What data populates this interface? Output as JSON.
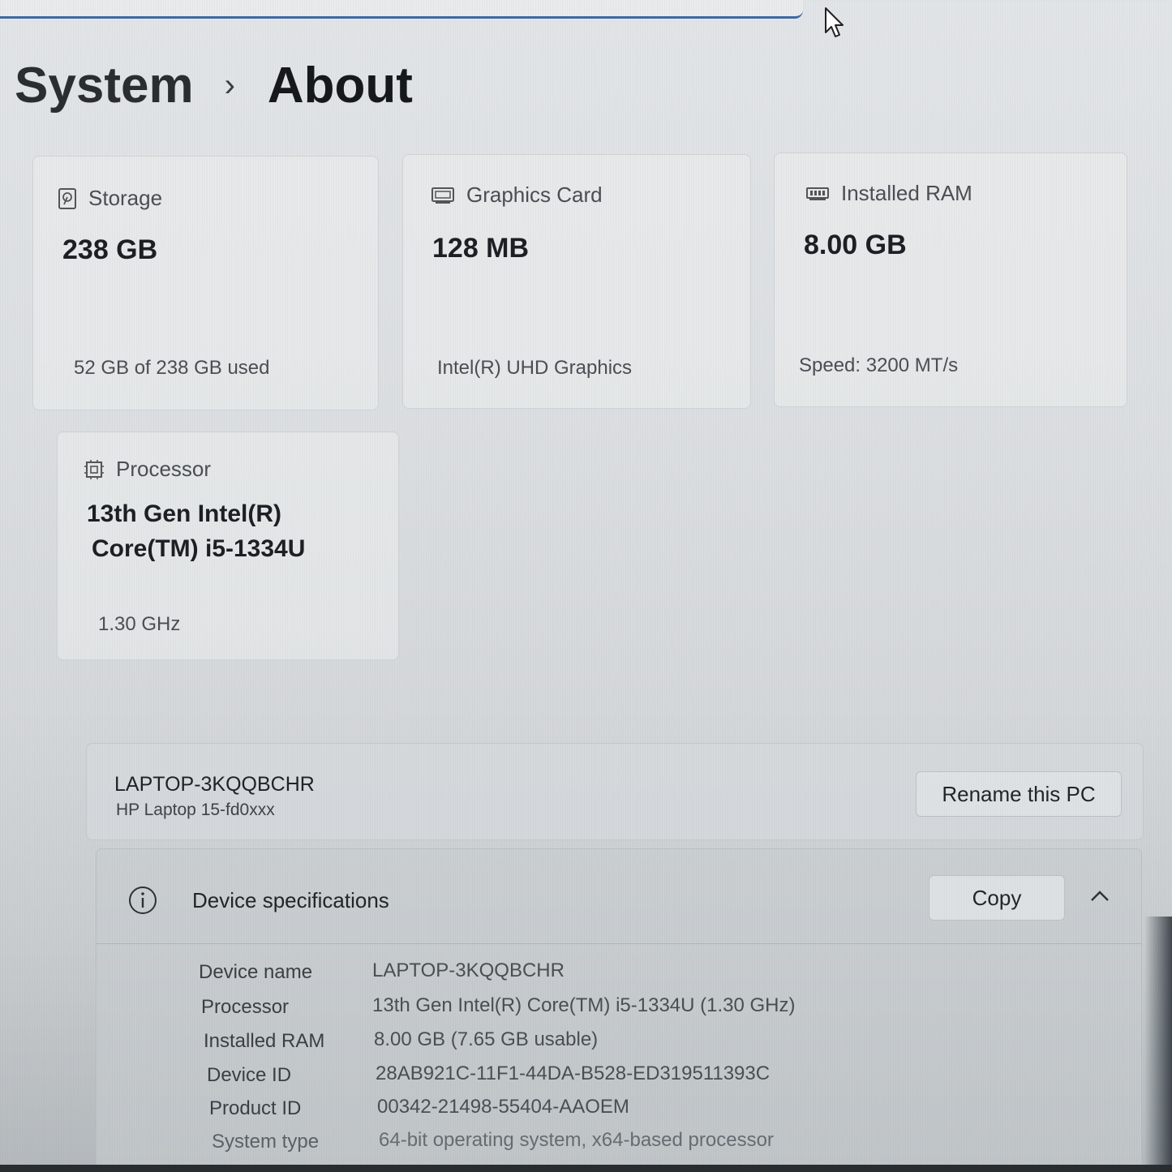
{
  "breadcrumb": {
    "parent": "System",
    "separator": "›",
    "current": "About"
  },
  "cards": {
    "storage": {
      "title": "Storage",
      "icon": "hard-drive-icon",
      "value": "238 GB",
      "detail": "52 GB of 238 GB used"
    },
    "graphics": {
      "title": "Graphics Card",
      "icon": "graphics-card-icon",
      "value": "128 MB",
      "detail": "Intel(R) UHD Graphics"
    },
    "ram": {
      "title": "Installed RAM",
      "icon": "ram-icon",
      "value": "8.00 GB",
      "detail": "Speed: 3200 MT/s"
    },
    "processor": {
      "title": "Processor",
      "icon": "processor-icon",
      "value_line1": "13th Gen Intel(R)",
      "value_line2": "Core(TM) i5-1334U",
      "detail": "1.30 GHz"
    }
  },
  "pc": {
    "name": "LAPTOP-3KQQBCHR",
    "model": "HP Laptop 15-fd0xxx",
    "rename_label": "Rename this PC"
  },
  "device_specs": {
    "title": "Device specifications",
    "copy_label": "Copy",
    "expanded": true,
    "rows": [
      {
        "label": "Device name",
        "value": "LAPTOP-3KQQBCHR"
      },
      {
        "label": "Processor",
        "value": "13th Gen Intel(R) Core(TM) i5-1334U (1.30 GHz)"
      },
      {
        "label": "Installed RAM",
        "value": "8.00 GB (7.65 GB usable)"
      },
      {
        "label": "Device ID",
        "value": "28AB921C-11F1-44DA-B528-ED319511393C"
      },
      {
        "label": "Product ID",
        "value": "00342-21498-55404-AAOEM"
      },
      {
        "label": "System type",
        "value": "64-bit operating system, x64-based processor"
      }
    ]
  },
  "colors": {
    "accent": "#3e6aa6",
    "text_primary": "#1c2024",
    "text_secondary": "#4a4f54"
  }
}
